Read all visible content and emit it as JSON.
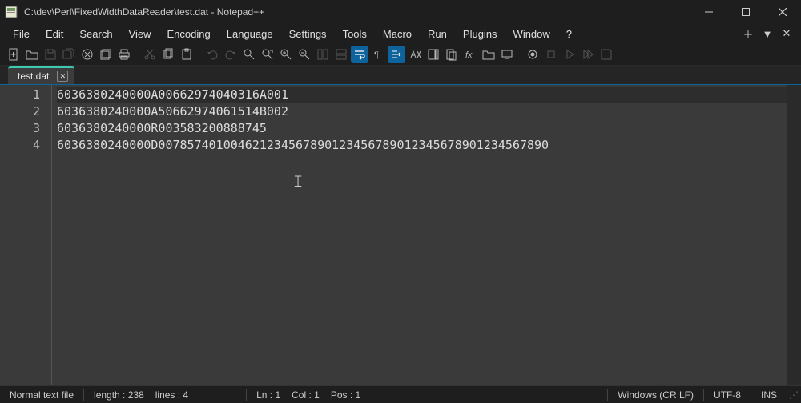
{
  "titlebar": {
    "title": "C:\\dev\\Perl\\FixedWidthDataReader\\test.dat - Notepad++"
  },
  "menu": {
    "items": [
      "File",
      "Edit",
      "Search",
      "View",
      "Encoding",
      "Language",
      "Settings",
      "Tools",
      "Macro",
      "Run",
      "Plugins",
      "Window",
      "?"
    ]
  },
  "tabs": {
    "active": "test.dat"
  },
  "editor": {
    "lines": [
      "6036380240000A00662974040316A001",
      "6036380240000A50662974061514B002",
      "6036380240000R003583200888745",
      "6036380240000D007857401004621234567890123456789012345678901234567890"
    ]
  },
  "status": {
    "filetype": "Normal text file",
    "length": "length : 238",
    "lines": "lines : 4",
    "ln": "Ln : 1",
    "col": "Col : 1",
    "pos": "Pos : 1",
    "eol": "Windows (CR LF)",
    "encoding": "UTF-8",
    "mode": "INS"
  }
}
